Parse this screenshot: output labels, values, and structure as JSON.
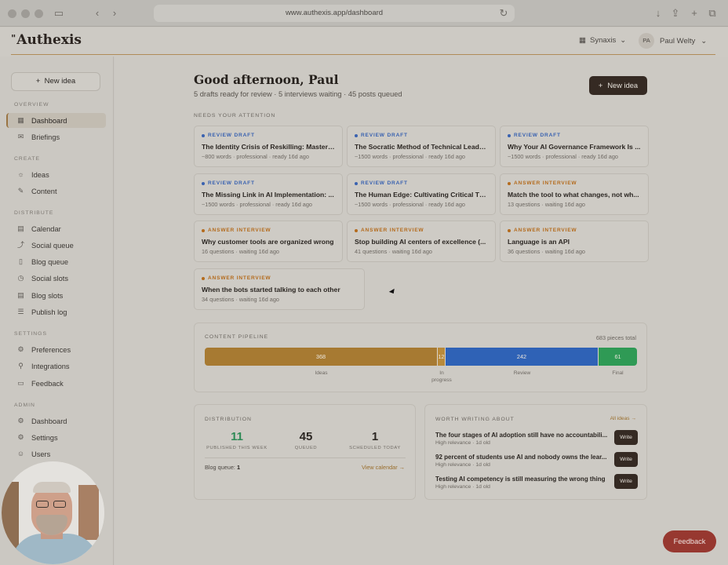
{
  "browser": {
    "url": "www.authexis.app/dashboard"
  },
  "brand": {
    "logo_mark": "\"",
    "name": "Authexis"
  },
  "header": {
    "workspace": "Synaxis",
    "user_initials": "PA",
    "user_name": "Paul Welty"
  },
  "sidebar": {
    "new_idea": "New idea",
    "sections": [
      {
        "label": "OVERVIEW",
        "items": [
          {
            "label": "Dashboard",
            "icon": "grid-icon",
            "active": true
          },
          {
            "label": "Briefings",
            "icon": "inbox-icon"
          }
        ]
      },
      {
        "label": "CREATE",
        "items": [
          {
            "label": "Ideas",
            "icon": "lightbulb-icon"
          },
          {
            "label": "Content",
            "icon": "pencil-icon"
          }
        ]
      },
      {
        "label": "DISTRIBUTE",
        "items": [
          {
            "label": "Calendar",
            "icon": "calendar-icon"
          },
          {
            "label": "Social queue",
            "icon": "share-icon"
          },
          {
            "label": "Blog queue",
            "icon": "document-icon"
          },
          {
            "label": "Social slots",
            "icon": "clock-icon"
          },
          {
            "label": "Blog slots",
            "icon": "calendar-icon"
          },
          {
            "label": "Publish log",
            "icon": "log-icon"
          }
        ]
      },
      {
        "label": "SETTINGS",
        "items": [
          {
            "label": "Preferences",
            "icon": "sliders-icon"
          },
          {
            "label": "Integrations",
            "icon": "plug-icon"
          },
          {
            "label": "Feedback",
            "icon": "chat-icon"
          }
        ]
      },
      {
        "label": "ADMIN",
        "items": [
          {
            "label": "Dashboard",
            "icon": "gear-icon"
          },
          {
            "label": "Settings",
            "icon": "gear-icon"
          },
          {
            "label": "Users",
            "icon": "users-icon"
          }
        ]
      }
    ]
  },
  "main": {
    "greeting": "Good afternoon, Paul",
    "summary": "5 drafts ready for review · 5 interviews waiting · 45 posts queued",
    "new_idea": "New idea",
    "needs_label": "NEEDS YOUR ATTENTION",
    "cards": [
      {
        "kind": "REVIEW DRAFT",
        "title": "The Identity Crisis of Reskilling: Mastering...",
        "meta": "~800 words · professional · ready 16d ago"
      },
      {
        "kind": "REVIEW DRAFT",
        "title": "The Socratic Method of Technical Leadership...",
        "meta": "~1500 words · professional · ready 16d ago"
      },
      {
        "kind": "REVIEW DRAFT",
        "title": "Why Your AI Governance Framework Is ...",
        "meta": "~1500 words · professional · ready 16d ago"
      },
      {
        "kind": "REVIEW DRAFT",
        "title": "The Missing Link in AI Implementation: ...",
        "meta": "~1500 words · professional · ready 16d ago"
      },
      {
        "kind": "REVIEW DRAFT",
        "title": "The Human Edge: Cultivating Critical Th...",
        "meta": "~1500 words · professional · ready 16d ago"
      },
      {
        "kind": "ANSWER INTERVIEW",
        "title": "Match the tool to what changes, not wh...",
        "meta": "13 questions · waiting 16d ago"
      },
      {
        "kind": "ANSWER INTERVIEW",
        "title": "Why customer tools are organized wrong",
        "meta": "16 questions · waiting 16d ago"
      },
      {
        "kind": "ANSWER INTERVIEW",
        "title": "Stop building AI centers of excellence (...",
        "meta": "41 questions · waiting 16d ago"
      },
      {
        "kind": "ANSWER INTERVIEW",
        "title": "Language is an API",
        "meta": "36 questions · waiting 16d ago"
      },
      {
        "kind": "ANSWER INTERVIEW",
        "title": "When the bots started talking to each other",
        "meta": "34 questions · waiting 16d ago"
      }
    ],
    "colors": {
      "review": "#3a62b0",
      "interview": "#b46b1d"
    }
  },
  "pipeline": {
    "label": "CONTENT PIPELINE",
    "total": "683 pieces total",
    "segments": [
      {
        "label": "Ideas",
        "value": 368,
        "color": "#a77a32"
      },
      {
        "label": "In progress",
        "value": 12,
        "color": "#b98a3a"
      },
      {
        "label": "Review",
        "value": 242,
        "color": "#2f62b6"
      },
      {
        "label": "Final",
        "value": 61,
        "color": "#2f9a55"
      }
    ]
  },
  "distribution": {
    "label": "DISTRIBUTION",
    "stats": [
      {
        "value": "11",
        "caption": "PUBLISHED THIS WEEK"
      },
      {
        "value": "45",
        "caption": "QUEUED"
      },
      {
        "value": "1",
        "caption": "SCHEDULED TODAY"
      }
    ],
    "blog_queue_label": "Blog queue:",
    "blog_queue_value": "1",
    "view_calendar": "View calendar →"
  },
  "worth": {
    "label": "WORTH WRITING ABOUT",
    "all_ideas": "All ideas →",
    "items": [
      {
        "title": "The four stages of AI adoption still have no accountabili...",
        "sub": "High relevance · 1d old",
        "button": "Write"
      },
      {
        "title": "92 percent of students use AI and nobody owns the lear...",
        "sub": "High relevance · 1d old",
        "button": "Write"
      },
      {
        "title": "Testing AI competency is still measuring the wrong thing",
        "sub": "High relevance · 1d old",
        "button": "Write"
      }
    ]
  },
  "feedback_button": "Feedback"
}
